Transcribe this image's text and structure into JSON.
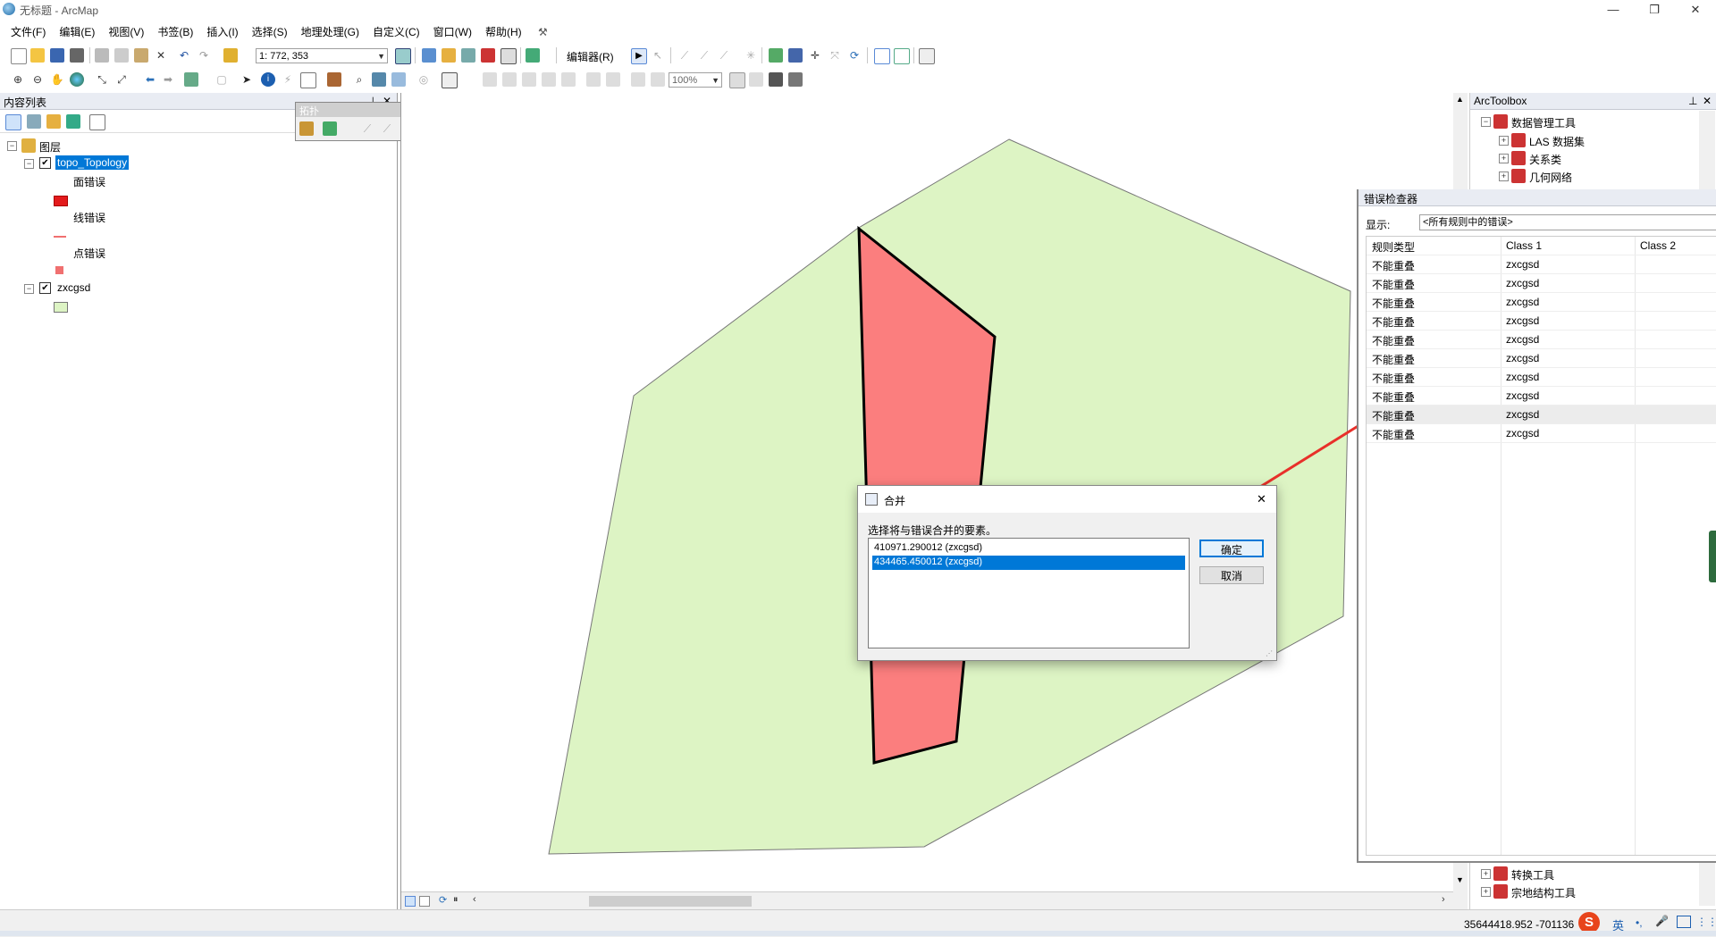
{
  "window": {
    "title": "无标题 - ArcMap",
    "min_icon": "—",
    "restore_icon": "❐",
    "close_icon": "✕"
  },
  "menu": [
    "文件(F)",
    "编辑(E)",
    "视图(V)",
    "书签(B)",
    "插入(I)",
    "选择(S)",
    "地理处理(G)",
    "自定义(C)",
    "窗口(W)",
    "帮助(H)"
  ],
  "toolbar": {
    "scale": "1: 772, 353",
    "editor_label": "编辑器(R)",
    "zoom_level": "100%"
  },
  "toc": {
    "header": "内容列表",
    "pin": "⊥",
    "close": "✕",
    "root": "图层",
    "layers": [
      {
        "name": "topo_Topology",
        "checked": true,
        "items": [
          {
            "label": "面错误",
            "symbol": "polygon-error"
          },
          {
            "label": "线错误",
            "symbol": "line-error"
          },
          {
            "label": "点错误",
            "symbol": "point-error"
          }
        ]
      },
      {
        "name": "zxcgsd",
        "checked": true,
        "items": [
          {
            "label": "",
            "symbol": "green-fill"
          }
        ]
      }
    ]
  },
  "topology_toolbar": {
    "title": "拓扑",
    "close": "✕"
  },
  "arctoolbox": {
    "title": "ArcToolbox",
    "pin": "⊥",
    "close": "✕",
    "items": [
      {
        "label": "数据管理工具",
        "level": 0,
        "expander": "−"
      },
      {
        "label": "LAS 数据集",
        "level": 1,
        "expander": "+"
      },
      {
        "label": "关系类",
        "level": 1,
        "expander": "+"
      },
      {
        "label": "几何网络",
        "level": 1,
        "expander": "+"
      }
    ],
    "bottom_items": [
      {
        "label": "转换工具",
        "expander": "+"
      },
      {
        "label": "宗地结构工具",
        "expander": "+"
      }
    ]
  },
  "error_inspector": {
    "title": "错误检查器",
    "show_label": "显示:",
    "show_value": "<所有规则中的错误>",
    "columns": [
      "规则类型",
      "Class 1",
      "Class 2"
    ],
    "rows": [
      [
        "不能重叠",
        "zxcgsd",
        ""
      ],
      [
        "不能重叠",
        "zxcgsd",
        ""
      ],
      [
        "不能重叠",
        "zxcgsd",
        ""
      ],
      [
        "不能重叠",
        "zxcgsd",
        ""
      ],
      [
        "不能重叠",
        "zxcgsd",
        ""
      ],
      [
        "不能重叠",
        "zxcgsd",
        ""
      ],
      [
        "不能重叠",
        "zxcgsd",
        ""
      ],
      [
        "不能重叠",
        "zxcgsd",
        ""
      ],
      [
        "不能重叠",
        "zxcgsd",
        ""
      ],
      [
        "不能重叠",
        "zxcgsd",
        ""
      ]
    ],
    "highlight_row": 8
  },
  "merge_dialog": {
    "title": "合并",
    "close": "✕",
    "prompt": "选择将与错误合并的要素。",
    "options": [
      "410971.290012 (zxcgsd)",
      "434465.450012 (zxcgsd)"
    ],
    "selected_index": 1,
    "ok_label": "确定",
    "cancel_label": "取消"
  },
  "status": {
    "coordinates": "35644418.952  -701136",
    "ime_label": "英"
  },
  "colors": {
    "green_fill": "#ddf4c4",
    "red_fill": "#fb7e7e",
    "selection_blue": "#0078d7",
    "arrow_red": "#e8302a"
  }
}
